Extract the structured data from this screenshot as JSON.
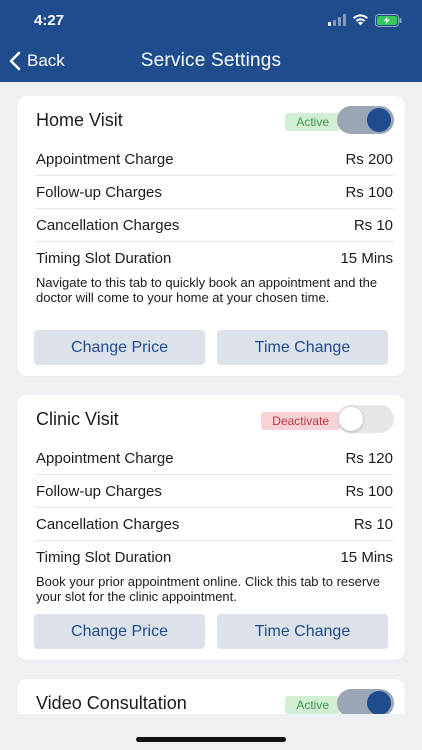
{
  "status": {
    "time": "4:27"
  },
  "nav": {
    "back_label": "Back",
    "title": "Service Settings"
  },
  "cards": [
    {
      "title": "Home Visit",
      "status": "Active",
      "enabled": true,
      "rows": [
        {
          "label": "Appointment Charge",
          "value": "Rs 200"
        },
        {
          "label": "Follow-up Charges",
          "value": "Rs 100"
        },
        {
          "label": "Cancellation Charges",
          "value": "Rs 10"
        },
        {
          "label": "Timing Slot Duration",
          "value": "15 Mins"
        }
      ],
      "description": "Navigate to this tab to quickly book an appointment and the doctor will come to your home at your chosen time.",
      "change_price_label": "Change Price",
      "time_change_label": "Time Change"
    },
    {
      "title": "Clinic Visit",
      "status": "Deactivate",
      "enabled": false,
      "rows": [
        {
          "label": "Appointment Charge",
          "value": "Rs 120"
        },
        {
          "label": "Follow-up Charges",
          "value": "Rs 100"
        },
        {
          "label": "Cancellation Charges",
          "value": "Rs 10"
        },
        {
          "label": "Timing Slot Duration",
          "value": "15 Mins"
        }
      ],
      "description": "Book your prior appointment online. Click this tab to reserve your slot for the clinic appointment.",
      "change_price_label": "Change Price",
      "time_change_label": "Time Change"
    },
    {
      "title": "Video Consultation",
      "status": "Active",
      "enabled": true
    }
  ],
  "colors": {
    "header": "#1e4c8d",
    "active_badge_bg": "#d2efd6",
    "inactive_badge_bg": "#f7d3d6",
    "button_bg": "#dde2ea"
  },
  "icons": {
    "back": "chevron-left-icon",
    "signal": "signal-icon",
    "wifi": "wifi-icon",
    "battery": "battery-charging-icon"
  }
}
